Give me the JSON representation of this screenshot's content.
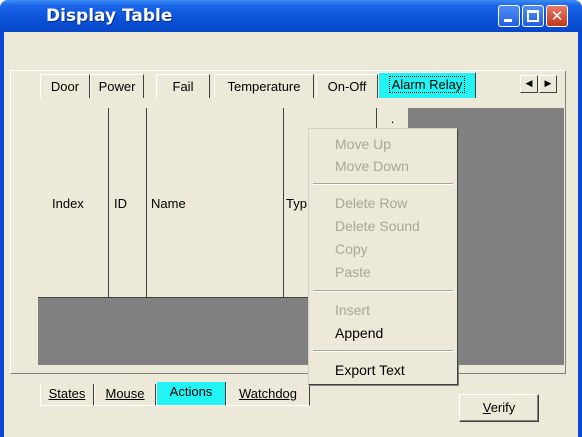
{
  "window": {
    "title": "Display Table",
    "controls": {
      "minimize": "minimize-icon",
      "maximize": "maximize-icon",
      "close": "close-icon"
    }
  },
  "top_tabs": [
    {
      "label": "Door",
      "active": false
    },
    {
      "label": "Power",
      "active": false
    },
    {
      "label": "Fail",
      "active": false
    },
    {
      "label": "Temperature",
      "active": false
    },
    {
      "label": "On-Off",
      "active": false
    },
    {
      "label": "Alarm Relay",
      "active": true
    }
  ],
  "tab_scroll": {
    "left": "◀",
    "right": "▶"
  },
  "grid": {
    "columns": [
      "Index",
      "ID",
      "Name",
      "Typ"
    ],
    "partial_header": "."
  },
  "context_menu": {
    "items": [
      {
        "label": "Move Up",
        "enabled": false
      },
      {
        "label": "Move Down",
        "enabled": false
      },
      {
        "separator": true
      },
      {
        "label": "Delete Row",
        "enabled": false
      },
      {
        "label": "Delete Sound",
        "enabled": false
      },
      {
        "label": "Copy",
        "enabled": false
      },
      {
        "label": "Paste",
        "enabled": false
      },
      {
        "separator": true
      },
      {
        "label": "Insert",
        "enabled": false
      },
      {
        "label": "Append",
        "enabled": true
      },
      {
        "separator": true
      },
      {
        "label": "Export Text",
        "enabled": true
      }
    ]
  },
  "bottom_tabs": [
    {
      "label": "States",
      "active": false
    },
    {
      "label": "Mouse",
      "active": false
    },
    {
      "label": "Actions",
      "active": true
    },
    {
      "label": "Watchdog",
      "active": false
    }
  ],
  "buttons": {
    "verify_mnemonic": "V",
    "verify_rest": "erify"
  },
  "colors": {
    "titlebar": "#0a52d8",
    "active_tab": "#22f4f4",
    "face": "#ece9d8",
    "grid_empty": "#808080",
    "disabled_text": "#a9a698"
  }
}
